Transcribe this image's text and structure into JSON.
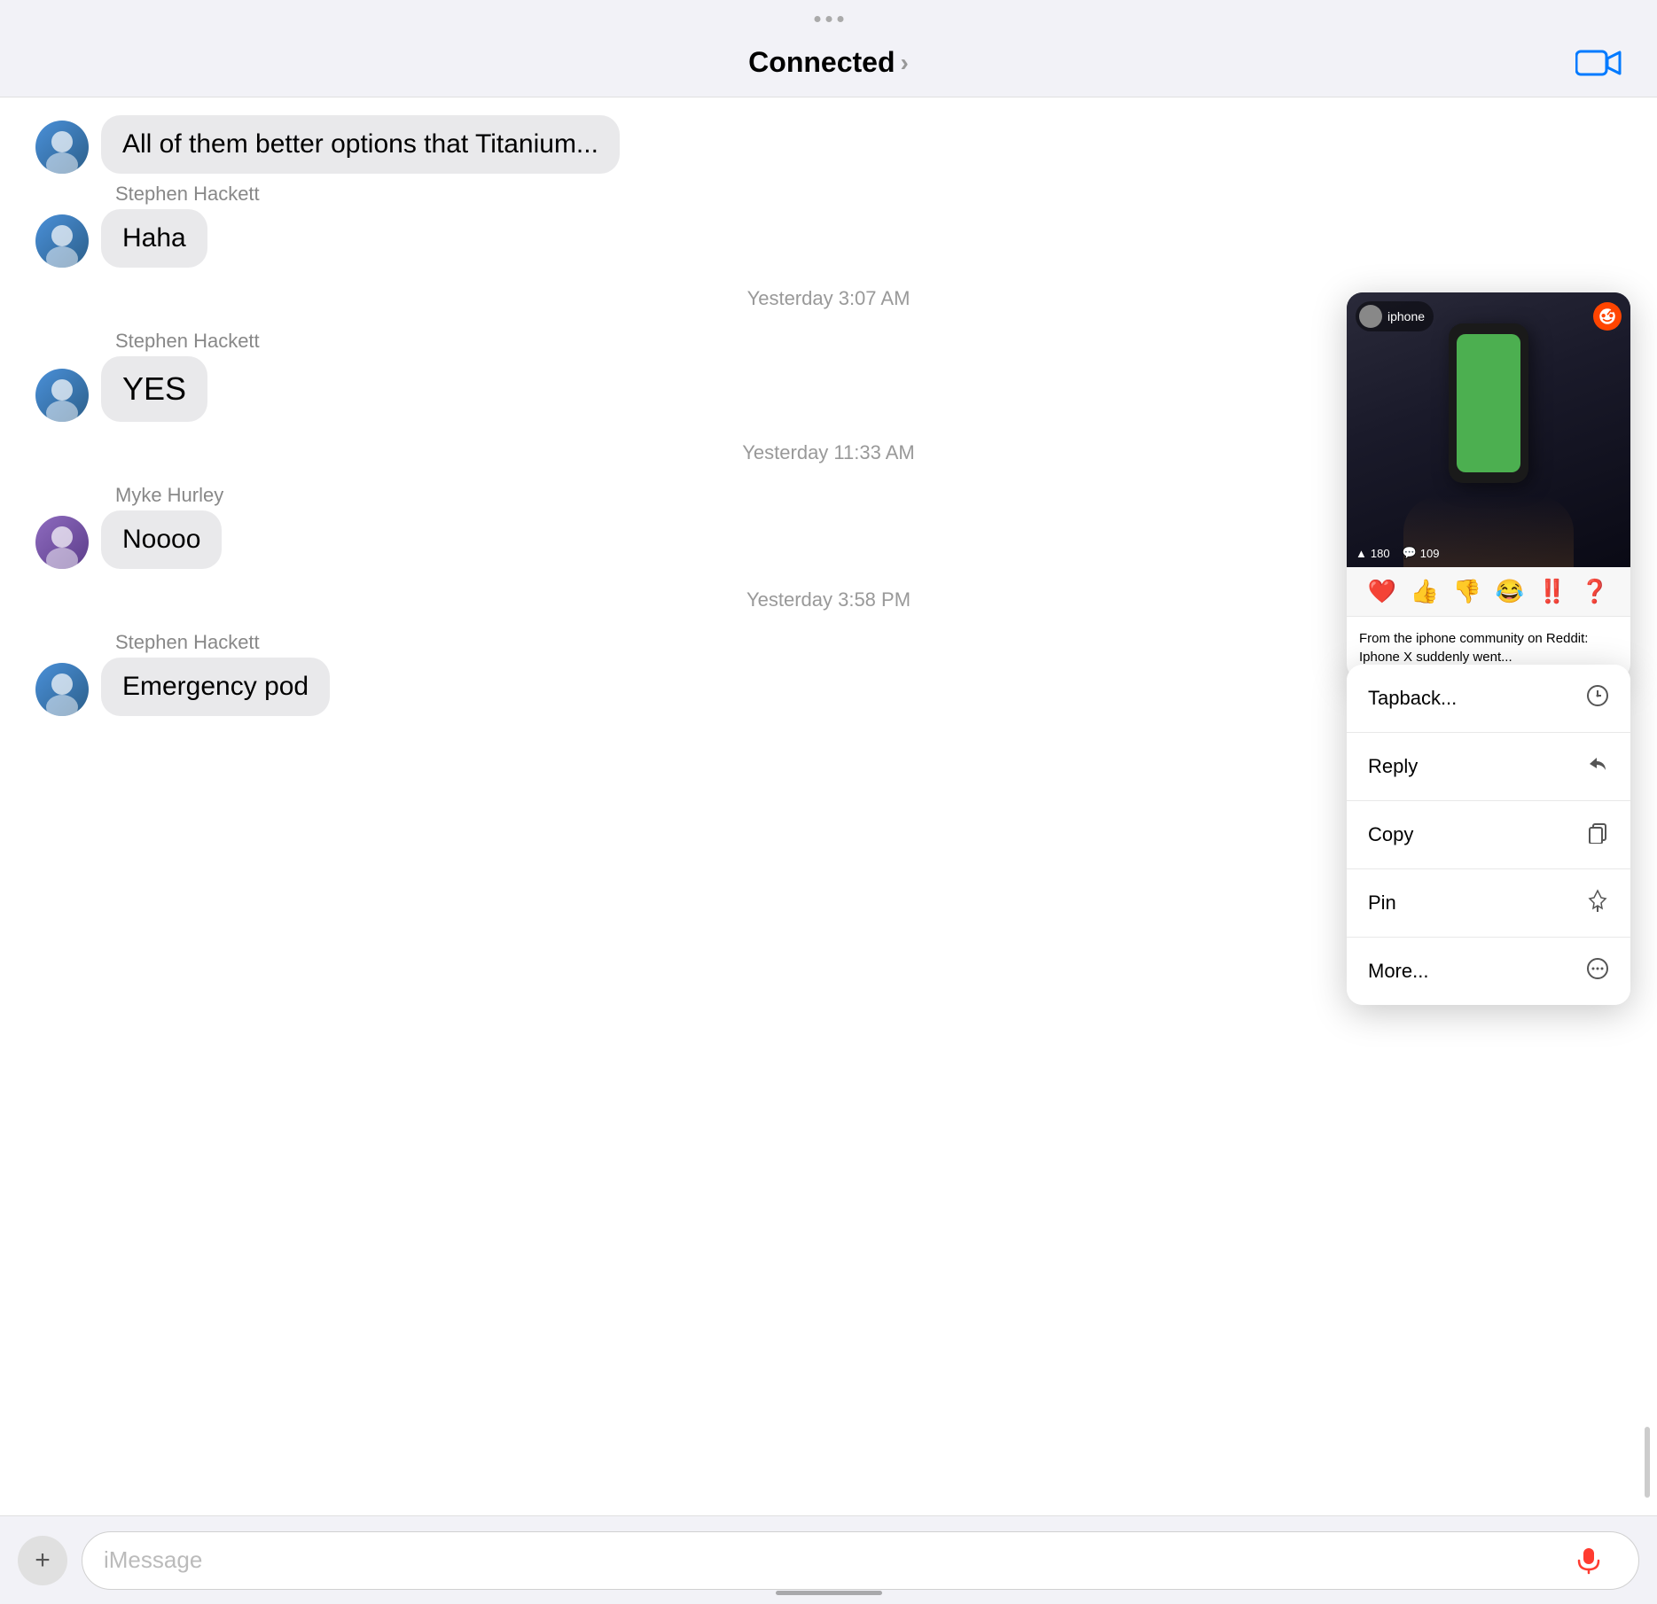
{
  "header": {
    "title": "Connected",
    "chevron": "›",
    "video_icon": "video",
    "dots": [
      "•",
      "•",
      "•"
    ]
  },
  "messages": [
    {
      "id": "msg1",
      "sender": "",
      "text": "All of them better options that Titanium...",
      "type": "truncated",
      "align": "left",
      "avatar": "other"
    },
    {
      "id": "msg2",
      "sender": "Stephen Hackett",
      "text": "Haha",
      "type": "normal",
      "align": "left",
      "avatar": "sh"
    },
    {
      "id": "ts1",
      "type": "timestamp",
      "text": "Yesterday 3:07 AM"
    },
    {
      "id": "msg3",
      "sender": "Stephen Hackett",
      "text": "YES",
      "type": "large",
      "align": "left",
      "avatar": "sh"
    },
    {
      "id": "ts2",
      "type": "timestamp",
      "text": "Yesterday 11:33 AM"
    },
    {
      "id": "msg4",
      "sender": "Myke Hurley",
      "text": "Noooo",
      "type": "normal",
      "align": "left",
      "avatar": "mh"
    },
    {
      "id": "ts3",
      "type": "timestamp",
      "text": "Yesterday 3:58 PM"
    },
    {
      "id": "msg5",
      "sender": "Stephen Hackett",
      "text": "Emergency pod",
      "type": "normal",
      "align": "left",
      "avatar": "sh"
    }
  ],
  "reddit_card": {
    "subreddit": "iphone",
    "reddit_logo": "r/",
    "upvotes": "180",
    "comments": "109",
    "description": "From the iphone community on Reddit: Iphone X suddenly went..."
  },
  "tapback_options": [
    "❤️",
    "👍",
    "👎",
    "😂",
    "‼️",
    "❓"
  ],
  "context_menu": {
    "items": [
      {
        "label": "Tapback...",
        "icon": "⊕"
      },
      {
        "label": "Reply",
        "icon": "↩"
      },
      {
        "label": "Copy",
        "icon": "⎘"
      },
      {
        "label": "Pin",
        "icon": "📌"
      },
      {
        "label": "More...",
        "icon": "⊙"
      }
    ]
  },
  "input_bar": {
    "placeholder": "iMessage",
    "add_icon": "+",
    "audio_icon": "🎙"
  }
}
